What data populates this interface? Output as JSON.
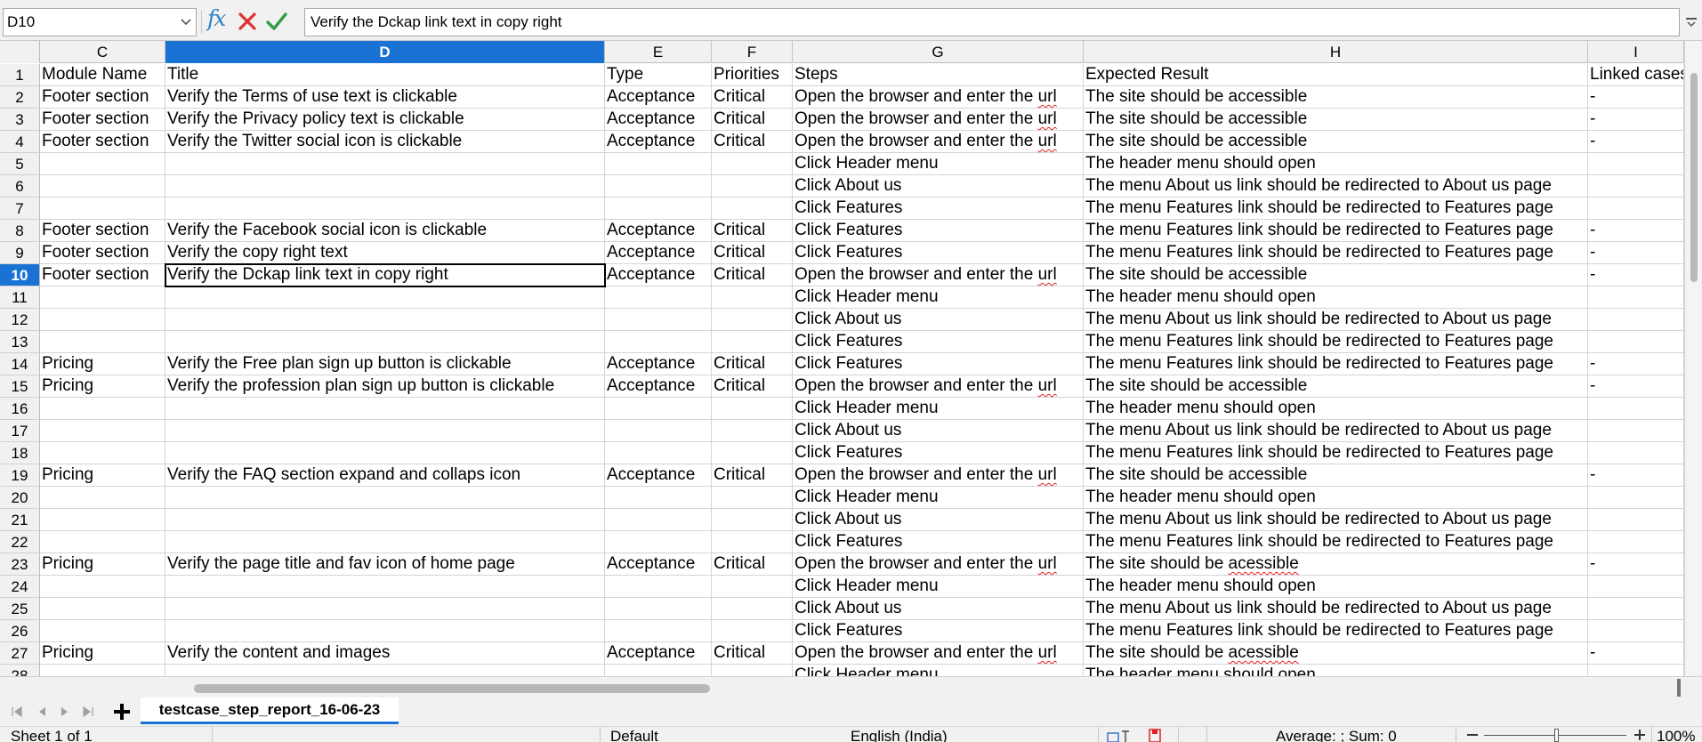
{
  "formula_bar": {
    "cell_reference": "D10",
    "content": "Verify the Dckap link text in copy right"
  },
  "icons": {
    "function": "fx",
    "cancel": "cancel-x-icon",
    "accept": "accept-check-icon"
  },
  "colors": {
    "selection": "#1a73d4",
    "cancel": "#e03131",
    "accept": "#2f9e44",
    "function": "#2d83c7"
  },
  "columns": [
    "C",
    "D",
    "E",
    "F",
    "G",
    "H",
    "I"
  ],
  "active_column": "D",
  "active_row": "10",
  "rows": [
    {
      "n": "1",
      "c": [
        "Module Name",
        "Title",
        "Type",
        "Priorities",
        "Steps",
        "Expected Result",
        "Linked cases"
      ]
    },
    {
      "n": "2",
      "c": [
        "Footer section",
        "Verify the Terms of use text is clickable",
        "Acceptance",
        "Critical",
        "Open the browser and enter the url",
        "The site should be accessible",
        "-"
      ]
    },
    {
      "n": "3",
      "c": [
        "Footer section",
        "Verify the Privacy policy text is clickable",
        "Acceptance",
        "Critical",
        "Open the browser and enter the url",
        "The site should be accessible",
        "-"
      ]
    },
    {
      "n": "4",
      "c": [
        "Footer section",
        "Verify the Twitter social icon is clickable",
        "Acceptance",
        "Critical",
        "Open the browser and enter the url",
        "The site should be accessible",
        "-"
      ]
    },
    {
      "n": "5",
      "c": [
        "",
        "",
        "",
        "",
        "Click Header menu",
        "The header menu should open",
        ""
      ]
    },
    {
      "n": "6",
      "c": [
        "",
        "",
        "",
        "",
        "Click About us",
        "The menu About us link should be redirected to About us page",
        ""
      ]
    },
    {
      "n": "7",
      "c": [
        "",
        "",
        "",
        "",
        "Click Features",
        "The menu Features link should be redirected to Features page",
        ""
      ]
    },
    {
      "n": "8",
      "c": [
        "Footer section",
        "Verify the Facebook social icon is clickable",
        "Acceptance",
        "Critical",
        "Click Features",
        "The menu Features link should be redirected to Features page",
        "-"
      ]
    },
    {
      "n": "9",
      "c": [
        "Footer section",
        "Verify the copy right text",
        "Acceptance",
        "Critical",
        "Click Features",
        "The menu Features link should be redirected to Features page",
        "-"
      ]
    },
    {
      "n": "10",
      "c": [
        "Footer section",
        "Verify the Dckap link text in copy right",
        "Acceptance",
        "Critical",
        "Open the browser and enter the url",
        "The site should be accessible",
        "-"
      ]
    },
    {
      "n": "11",
      "c": [
        "",
        "",
        "",
        "",
        "Click Header menu",
        "The header menu should open",
        ""
      ]
    },
    {
      "n": "12",
      "c": [
        "",
        "",
        "",
        "",
        "Click About us",
        "The menu About us link should be redirected to About us page",
        ""
      ]
    },
    {
      "n": "13",
      "c": [
        "",
        "",
        "",
        "",
        "Click Features",
        "The menu Features link should be redirected to Features page",
        ""
      ]
    },
    {
      "n": "14",
      "c": [
        "Pricing",
        "Verify the Free plan sign up button is clickable",
        "Acceptance",
        "Critical",
        "Click Features",
        "The menu Features link should be redirected to Features page",
        "-"
      ]
    },
    {
      "n": "15",
      "c": [
        "Pricing",
        "Verify the profession plan sign up button is clickable",
        "Acceptance",
        "Critical",
        "Open the browser and enter the url",
        "The site should be accessible",
        "-"
      ]
    },
    {
      "n": "16",
      "c": [
        "",
        "",
        "",
        "",
        "Click Header menu",
        "The header menu should open",
        ""
      ]
    },
    {
      "n": "17",
      "c": [
        "",
        "",
        "",
        "",
        "Click About us",
        "The menu About us link should be redirected to About us page",
        ""
      ]
    },
    {
      "n": "18",
      "c": [
        "",
        "",
        "",
        "",
        "Click Features",
        "The menu Features link should be redirected to Features page",
        ""
      ]
    },
    {
      "n": "19",
      "c": [
        "Pricing",
        "Verify the FAQ section expand and collaps icon",
        "Acceptance",
        "Critical",
        "Open the browser and enter the url",
        "The site should be accessible",
        "-"
      ]
    },
    {
      "n": "20",
      "c": [
        "",
        "",
        "",
        "",
        "Click Header menu",
        "The header menu should open",
        ""
      ]
    },
    {
      "n": "21",
      "c": [
        "",
        "",
        "",
        "",
        "Click About us",
        "The menu About us link should be redirected to About us page",
        ""
      ]
    },
    {
      "n": "22",
      "c": [
        "",
        "",
        "",
        "",
        "Click Features",
        "The menu Features link should be redirected to Features page",
        ""
      ]
    },
    {
      "n": "23",
      "c": [
        "Pricing",
        "Verify the page title and fav icon of home page",
        "Acceptance",
        "Critical",
        "Open the browser and enter the url",
        "The site should be acessible",
        "-"
      ]
    },
    {
      "n": "24",
      "c": [
        "",
        "",
        "",
        "",
        "Click Header menu",
        "The header menu should open",
        ""
      ]
    },
    {
      "n": "25",
      "c": [
        "",
        "",
        "",
        "",
        "Click About us",
        "The menu About us link should be redirected to About us page",
        ""
      ]
    },
    {
      "n": "26",
      "c": [
        "",
        "",
        "",
        "",
        "Click Features",
        "The menu Features link should be redirected to Features page",
        ""
      ]
    },
    {
      "n": "27",
      "c": [
        "Pricing",
        "Verify the content and images",
        "Acceptance",
        "Critical",
        "Open the browser and enter the url",
        "The site should be acessible",
        "-"
      ]
    },
    {
      "n": "28",
      "c": [
        "",
        "",
        "",
        "",
        "Click Header menu",
        "The header menu should open",
        ""
      ]
    }
  ],
  "sheet_tab": "testcase_step_report_16-06-23",
  "status_bar": {
    "sheet": "Sheet 1 of 1",
    "page_style": "Default",
    "language": "English (India)",
    "summary": "Average: ; Sum: 0",
    "zoom": "100%"
  }
}
